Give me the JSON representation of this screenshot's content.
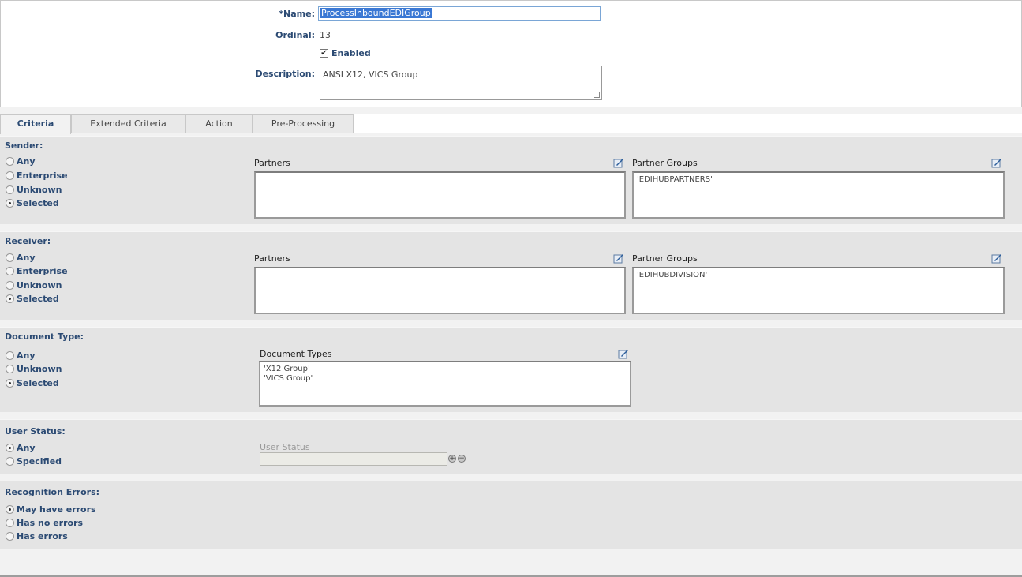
{
  "header": {
    "name_label": "*Name:",
    "name_value": "ProcessInboundEDIGroup",
    "ordinal_label": "Ordinal:",
    "ordinal_value": "13",
    "enabled_label": "Enabled",
    "enabled_checked": true,
    "description_label": "Description:",
    "description_value": "ANSI X12,  VICS Group"
  },
  "tabs": [
    {
      "label": "Criteria",
      "active": true
    },
    {
      "label": "Extended Criteria",
      "active": false
    },
    {
      "label": "Action",
      "active": false
    },
    {
      "label": "Pre-Processing",
      "active": false
    }
  ],
  "sender": {
    "title": "Sender:",
    "options": [
      "Any",
      "Enterprise",
      "Unknown",
      "Selected"
    ],
    "selected": "Selected",
    "partners_label": "Partners",
    "partners": [],
    "partner_groups_label": "Partner Groups",
    "partner_groups": [
      "'EDIHUBPARTNERS'"
    ]
  },
  "receiver": {
    "title": "Receiver:",
    "options": [
      "Any",
      "Enterprise",
      "Unknown",
      "Selected"
    ],
    "selected": "Selected",
    "partners_label": "Partners",
    "partners": [],
    "partner_groups_label": "Partner Groups",
    "partner_groups": [
      "'EDIHUBDIVISION'"
    ]
  },
  "document_type": {
    "title": "Document Type:",
    "options": [
      "Any",
      "Unknown",
      "Selected"
    ],
    "selected": "Selected",
    "types_label": "Document Types",
    "types": [
      "'X12 Group'",
      "'VICS Group'"
    ]
  },
  "user_status": {
    "title": "User Status:",
    "options": [
      "Any",
      "Specified"
    ],
    "selected": "Any",
    "field_label": "User Status",
    "field_value": ""
  },
  "recognition_errors": {
    "title": "Recognition Errors:",
    "options": [
      "May have errors",
      "Has no errors",
      "Has errors"
    ],
    "selected": "May have errors"
  },
  "icons": {
    "edit": "edit-icon",
    "add": "plus-circle-icon",
    "remove": "minus-circle-icon"
  }
}
